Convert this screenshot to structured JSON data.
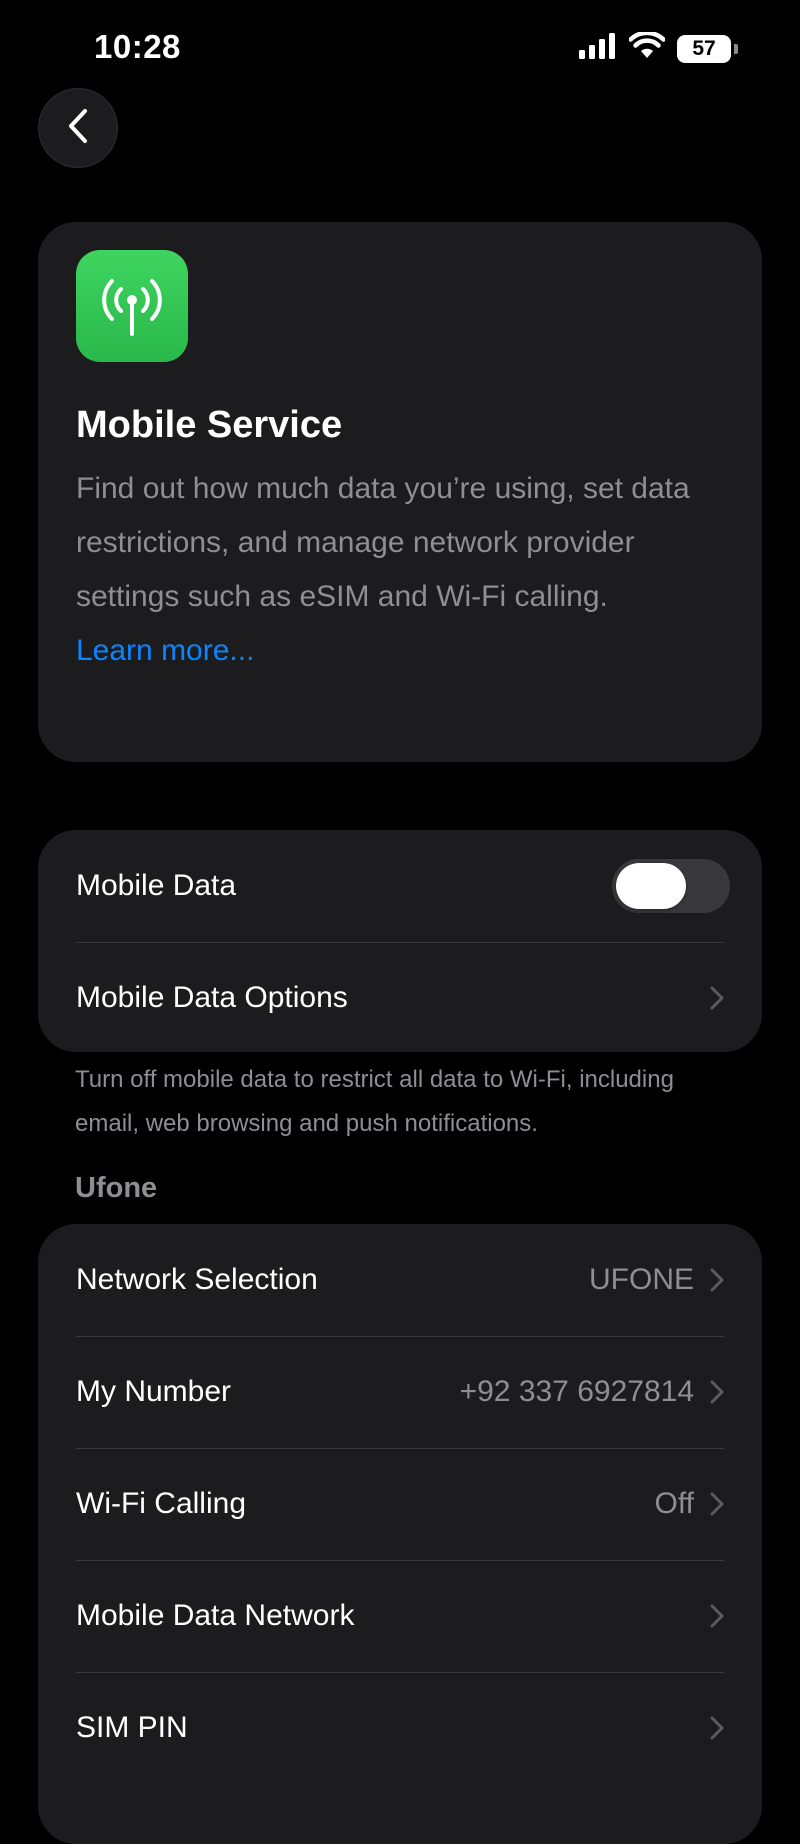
{
  "status_bar": {
    "time": "10:28",
    "battery": "57",
    "icons": [
      "signal-icon",
      "wifi-icon",
      "battery-icon"
    ]
  },
  "nav": {
    "back_icon": "chevron-left-icon"
  },
  "intro": {
    "icon": "antenna-icon",
    "icon_color": "#34c759",
    "title": "Mobile Service",
    "description": "Find out how much data you’re using, set data restrictions, and manage network provider settings such as eSIM and Wi-Fi calling.",
    "link": "Learn more..."
  },
  "data_section": {
    "mobile_data_label": "Mobile Data",
    "mobile_data_on": false,
    "options_label": "Mobile Data Options",
    "footer": "Turn off mobile data to restrict all data to Wi-Fi, including email, web browsing and push notifications."
  },
  "carrier_section": {
    "header": "Ufone",
    "rows": [
      {
        "label": "Network Selection",
        "value": "UFONE"
      },
      {
        "label": "My Number",
        "value": "+92 337 6927814"
      },
      {
        "label": "Wi-Fi Calling",
        "value": "Off"
      },
      {
        "label": "Mobile Data Network",
        "value": ""
      },
      {
        "label": "SIM PIN",
        "value": ""
      }
    ]
  },
  "colors": {
    "background": "#000000",
    "card": "#1c1c1e",
    "accent": "#0a84ff",
    "secondary_text": "#8e8e93"
  }
}
